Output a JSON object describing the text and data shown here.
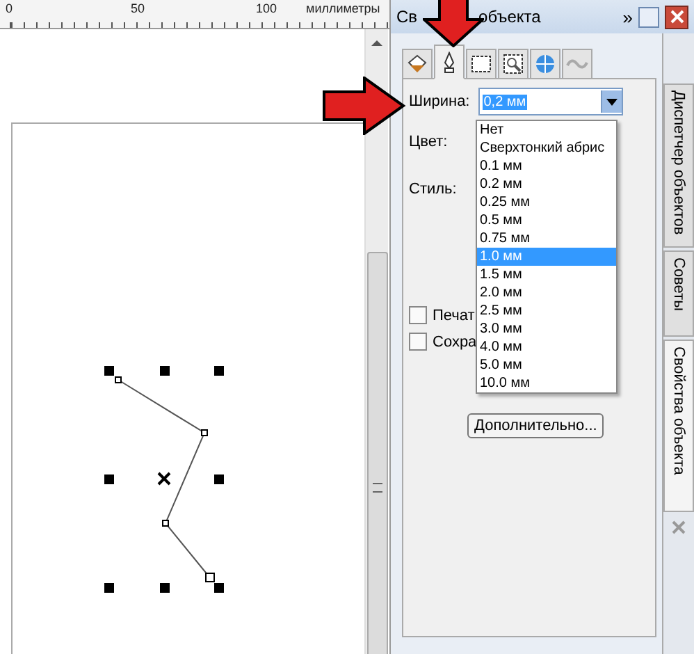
{
  "ruler": {
    "labels": [
      "0",
      "50",
      "100"
    ],
    "unit": "миллиметры"
  },
  "panel": {
    "title_start": "Св",
    "title_end": "объекта",
    "overflow": "»",
    "tabs": [
      {
        "kind": "fill",
        "selected": false
      },
      {
        "kind": "pen",
        "selected": true
      },
      {
        "kind": "frame",
        "selected": false
      },
      {
        "kind": "zoom",
        "selected": false
      },
      {
        "kind": "globe",
        "selected": false
      },
      {
        "kind": "wave",
        "selected": false
      }
    ],
    "width_field": {
      "label": "Ширина:",
      "value": "0,2 мм",
      "expanded": true
    },
    "options": [
      {
        "label": "Нет",
        "selected": false
      },
      {
        "label": "Сверхтонкий абрис",
        "selected": false
      },
      {
        "label": "0.1 мм",
        "selected": false
      },
      {
        "label": "0.2 мм",
        "selected": false
      },
      {
        "label": "0.25 мм",
        "selected": false
      },
      {
        "label": "0.5 мм",
        "selected": false
      },
      {
        "label": "0.75 мм",
        "selected": false
      },
      {
        "label": "1.0 мм",
        "selected": true
      },
      {
        "label": "1.5 мм",
        "selected": false
      },
      {
        "label": "2.0 мм",
        "selected": false
      },
      {
        "label": "2.5 мм",
        "selected": false
      },
      {
        "label": "3.0 мм",
        "selected": false
      },
      {
        "label": "4.0 мм",
        "selected": false
      },
      {
        "label": "5.0 мм",
        "selected": false
      },
      {
        "label": "10.0 мм",
        "selected": false
      }
    ],
    "color_label": "Цвет:",
    "style_label": "Стиль:",
    "checkboxes": [
      {
        "label": "Печат",
        "checked": false
      },
      {
        "label": "Сохра",
        "checked": false
      }
    ],
    "button": "Дополнительно..."
  },
  "side_tabs": [
    {
      "label": "Диспетчер объектов",
      "selected": false
    },
    {
      "label": "Советы",
      "selected": false
    },
    {
      "label": "Свойства объекта",
      "selected": true
    }
  ]
}
